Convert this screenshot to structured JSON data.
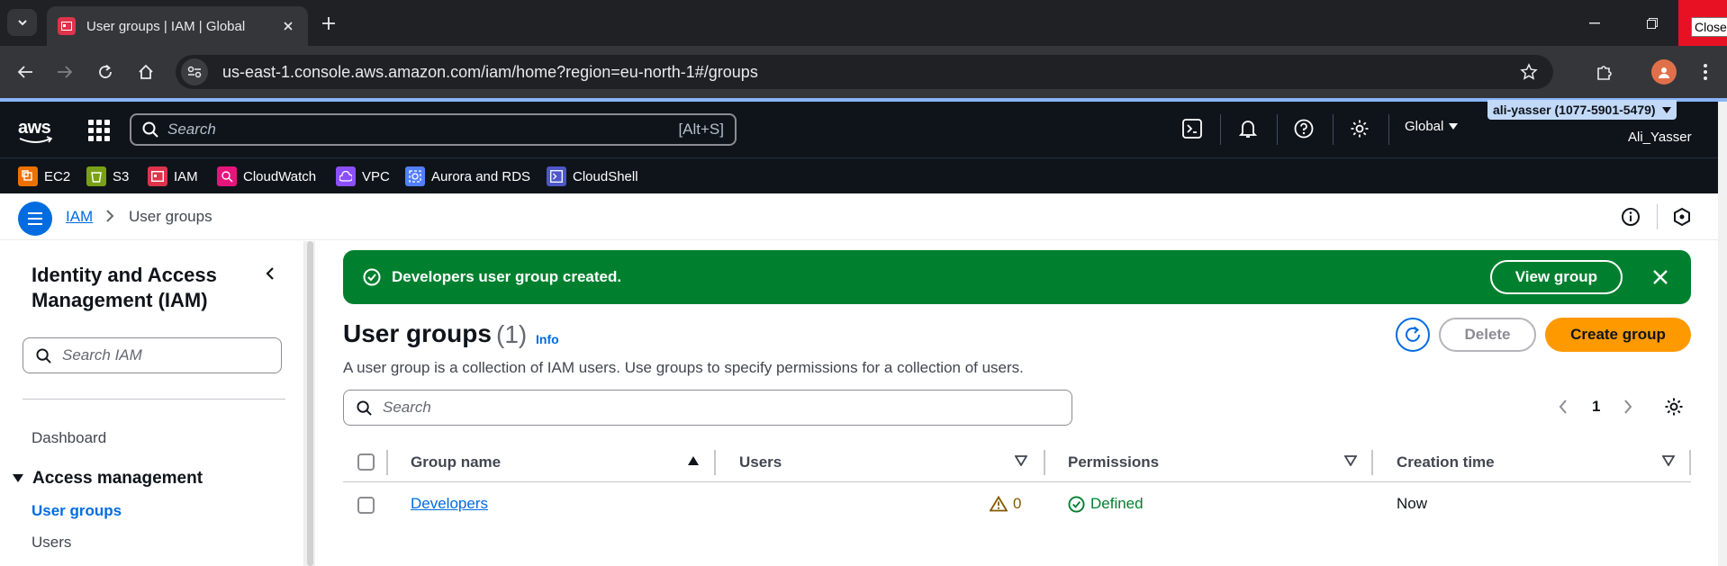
{
  "browser": {
    "tab_title": "User groups | IAM | Global",
    "url": "us-east-1.console.aws.amazon.com/iam/home?region=eu-north-1#/groups",
    "close_tooltip": "Close"
  },
  "aws_nav": {
    "logo": "aws",
    "search_placeholder": "Search",
    "search_shortcut": "[Alt+S]",
    "region": "Global",
    "account": "ali-yasser (1077-5901-5479)",
    "username": "Ali_Yasser",
    "favorites": [
      {
        "label": "EC2",
        "color": "#ed7100"
      },
      {
        "label": "S3",
        "color": "#7aa116"
      },
      {
        "label": "IAM",
        "color": "#dd344c"
      },
      {
        "label": "CloudWatch",
        "color": "#e7157b"
      },
      {
        "label": "VPC",
        "color": "#8c4fff"
      },
      {
        "label": "Aurora and RDS",
        "color": "#527fff"
      },
      {
        "label": "CloudShell",
        "color": "#4d57c8"
      }
    ]
  },
  "breadcrumb": {
    "root": "IAM",
    "current": "User groups"
  },
  "sidebar": {
    "title": "Identity and Access Management (IAM)",
    "search_placeholder": "Search IAM",
    "dashboard": "Dashboard",
    "section": "Access management",
    "items": [
      "User groups",
      "Users"
    ]
  },
  "flash": {
    "message": "Developers user group created.",
    "action": "View group"
  },
  "page": {
    "title": "User groups",
    "count": "(1)",
    "info": "Info",
    "description": "A user group is a collection of IAM users. Use groups to specify permissions for a collection of users.",
    "delete_label": "Delete",
    "create_label": "Create group",
    "search_placeholder": "Search",
    "page_number": "1"
  },
  "table": {
    "columns": [
      "Group name",
      "Users",
      "Permissions",
      "Creation time"
    ],
    "rows": [
      {
        "group_name": "Developers",
        "users": "0",
        "permissions": "Defined",
        "creation_time": "Now"
      }
    ]
  },
  "colors": {
    "aws_nav_bg": "#0f141a",
    "link": "#006ce0",
    "success": "#00802f",
    "primary_button": "#ff9900",
    "warning": "#855900"
  }
}
